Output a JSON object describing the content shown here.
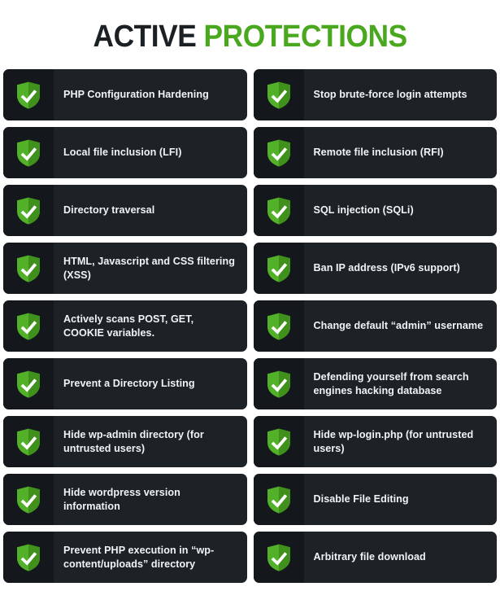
{
  "header": {
    "title_part_dark": "ACTIVE",
    "title_part_accent": "PROTECTIONS",
    "accent_color": "#4aa81e",
    "dark_color": "#1b2025"
  },
  "theme": {
    "card_background": "#1d2227",
    "card_icon_background": "#14181c",
    "card_text_color": "#f1f3f4",
    "shield_green": "#52b128",
    "shield_green_dark": "#3e8f1b",
    "check_color": "#ffffff",
    "page_background": "#ffffff"
  },
  "protections": {
    "icon_name": "shield-check-icon",
    "items": [
      {
        "column": "left",
        "row": 1,
        "label": "PHP Configuration Hardening"
      },
      {
        "column": "right",
        "row": 1,
        "label": "Stop brute-force login attempts"
      },
      {
        "column": "left",
        "row": 2,
        "label": "Local file inclusion (LFI)"
      },
      {
        "column": "right",
        "row": 2,
        "label": "Remote file inclusion (RFI)"
      },
      {
        "column": "left",
        "row": 3,
        "label": "Directory traversal"
      },
      {
        "column": "right",
        "row": 3,
        "label": "SQL injection (SQLi)"
      },
      {
        "column": "left",
        "row": 4,
        "label": "HTML, Javascript and CSS filtering (XSS)"
      },
      {
        "column": "right",
        "row": 4,
        "label": "Ban IP address (IPv6 support)"
      },
      {
        "column": "left",
        "row": 5,
        "label": "Actively scans POST, GET, COOKIE variables."
      },
      {
        "column": "right",
        "row": 5,
        "label": "Change default “admin” username"
      },
      {
        "column": "left",
        "row": 6,
        "label": "Prevent a Directory Listing"
      },
      {
        "column": "right",
        "row": 6,
        "label": "Defending yourself from search engines hacking database"
      },
      {
        "column": "left",
        "row": 7,
        "label": "Hide wp-admin directory (for untrusted users)"
      },
      {
        "column": "right",
        "row": 7,
        "label": "Hide wp-login.php (for untrusted users)"
      },
      {
        "column": "left",
        "row": 8,
        "label": "Hide wordpress version information"
      },
      {
        "column": "right",
        "row": 8,
        "label": "Disable File Editing"
      },
      {
        "column": "left",
        "row": 9,
        "label": "Prevent PHP execution in “wp-content/uploads” directory"
      },
      {
        "column": "right",
        "row": 9,
        "label": "Arbitrary file download"
      }
    ]
  }
}
